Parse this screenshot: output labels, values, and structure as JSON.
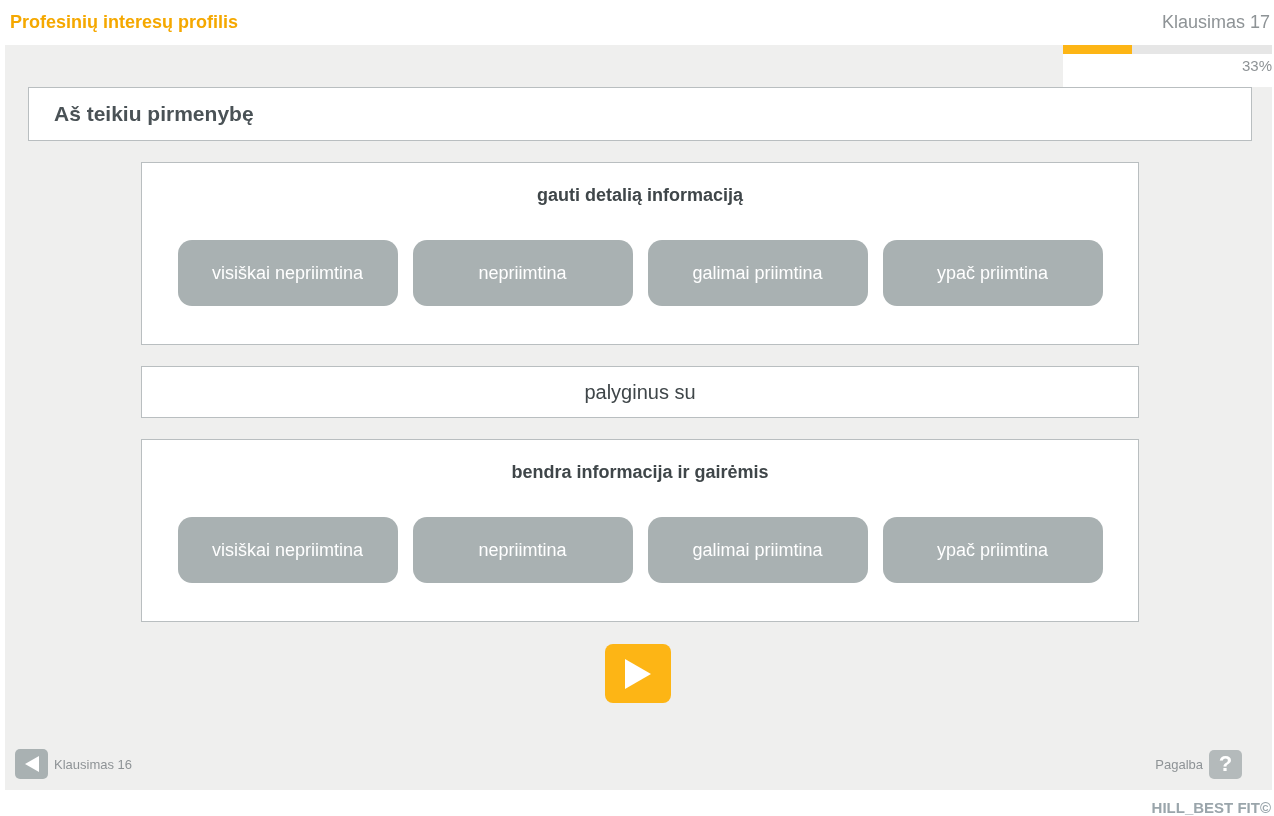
{
  "header": {
    "title": "Profesinių interesų profilis",
    "question_counter": "Klausimas 17"
  },
  "progress": {
    "level": 0.33,
    "reading": "33%"
  },
  "question": "Aš teikiu pirmenybę",
  "statements": [
    {
      "text": "gauti detalią informaciją",
      "options": [
        {
          "label": "visiškai nepriimtina",
          "selected": false
        },
        {
          "label": "nepriimtina",
          "selected": false
        },
        {
          "label": "galimai priimtina",
          "selected": false
        },
        {
          "label": "ypač priimtina",
          "selected": false
        }
      ]
    },
    {
      "text": "bendra informacija ir gairėmis",
      "options": [
        {
          "label": "visiškai nepriimtina",
          "selected": false
        },
        {
          "label": "nepriimtina",
          "selected": false
        },
        {
          "label": "galimai priimtina",
          "selected": false
        },
        {
          "label": "ypač priimtina",
          "selected": false
        }
      ]
    }
  ],
  "separator": "palyginus su",
  "footer": {
    "back_label": "Klausimas 16",
    "help_label": "Pagalba",
    "help_key": "?"
  },
  "brand": "HILL_BEST FIT©"
}
